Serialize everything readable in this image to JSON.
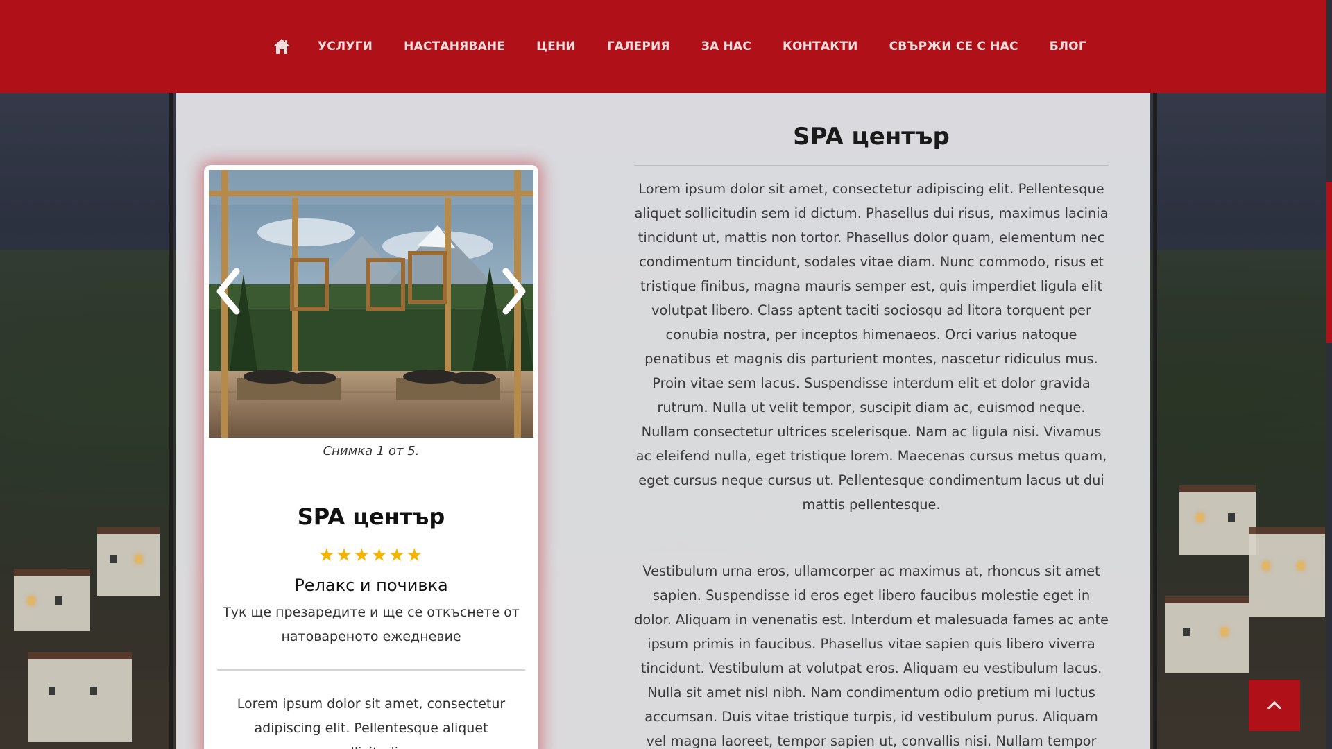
{
  "nav": {
    "home_icon": "home-icon",
    "items": [
      {
        "label": "УСЛУГИ"
      },
      {
        "label": "НАСТАНЯВАНЕ"
      },
      {
        "label": "ЦЕНИ"
      },
      {
        "label": "ГАЛЕРИЯ"
      },
      {
        "label": "ЗА НАС"
      },
      {
        "label": "КОНТАКТИ"
      },
      {
        "label": "СВЪРЖИ СЕ С НАС"
      },
      {
        "label": "БЛОГ"
      }
    ]
  },
  "colors": {
    "brand_red": "#b01018",
    "star_gold": "#f4b400",
    "panel_bg": "#e8e8ec"
  },
  "card": {
    "slider": {
      "caption": "Снимка 1 от 5.",
      "prev_icon": "chevron-left-icon",
      "next_icon": "chevron-right-icon"
    },
    "title": "SPA център",
    "rating": 6,
    "stars": "★★★★★★",
    "subtitle": "Релакс и почивка",
    "description": "Тук ще презаредите и ще се откъснете от натовареното ежедневие",
    "body": "Lorem ipsum dolor sit amet, consectetur adipiscing elit. Pellentesque aliquet sollicitudin"
  },
  "content": {
    "title": "SPA център",
    "paragraph1": "Lorem ipsum dolor sit amet, consectetur adipiscing elit. Pellentesque aliquet sollicitudin sem id dictum. Phasellus dui risus, maximus lacinia tincidunt ut, mattis non tortor. Phasellus dolor quam, elementum nec condimentum tincidunt, sodales vitae diam. Nunc commodo, risus et tristique finibus, magna mauris semper est, quis imperdiet ligula elit volutpat libero. Class aptent taciti sociosqu ad litora torquent per conubia nostra, per inceptos himenaeos. Orci varius natoque penatibus et magnis dis parturient montes, nascetur ridiculus mus. Proin vitae sem lacus. Suspendisse interdum elit et dolor gravida rutrum. Nulla ut velit tempor, suscipit diam ac, euismod neque. Nullam consectetur ultrices scelerisque. Nam ac ligula nisi. Vivamus ac eleifend nulla, eget tristique lorem. Maecenas cursus metus quam, eget cursus neque cursus ut. Pellentesque condimentum lacus ut dui mattis pellentesque.",
    "paragraph2": "Vestibulum urna eros, ullamcorper ac maximus at, rhoncus sit amet sapien. Suspendisse id eros eget libero faucibus molestie eget in dolor. Aliquam in venenatis est. Interdum et malesuada fames ac ante ipsum primis in faucibus. Phasellus vitae sapien quis libero viverra tincidunt. Vestibulum at volutpat eros. Aliquam eu vestibulum lacus. Nulla sit amet nisl nibh. Nam condimentum odio pretium mi luctus accumsan. Duis vitae tristique turpis, id vestibulum purus. Aliquam vel magna laoreet, tempor sapien ut, convallis nisi. Nullam tempor turpis sit amet augue porttitor, non"
  },
  "scroll_top": {
    "icon": "chevron-up-icon"
  }
}
